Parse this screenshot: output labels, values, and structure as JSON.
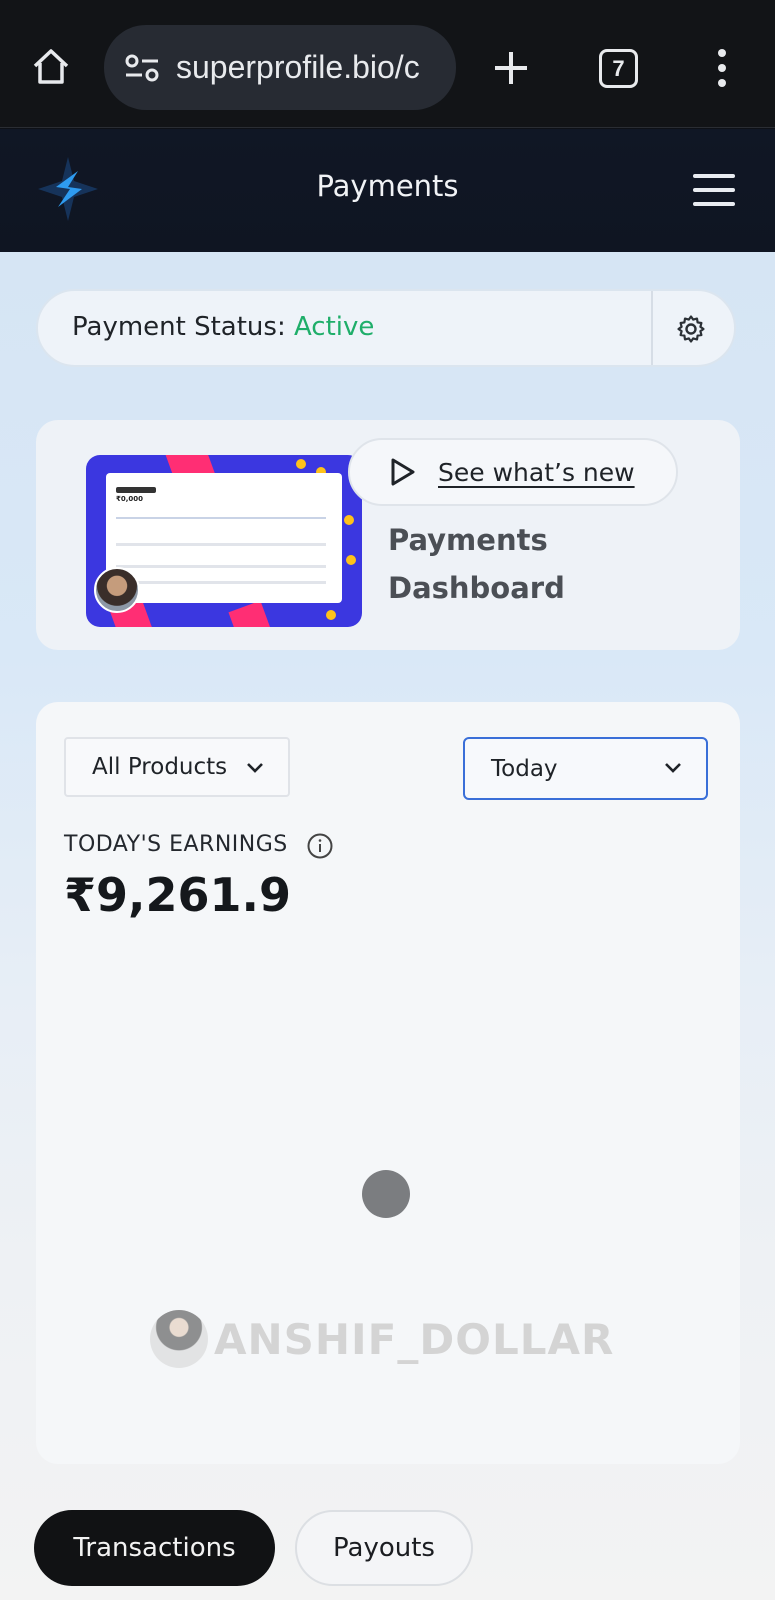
{
  "browser": {
    "url": "superprofile.bio/c",
    "tab_count": "7",
    "icons": {
      "home": "home-icon",
      "site_settings": "tune-icon",
      "new_tab": "plus-icon",
      "menu": "kebab-menu-icon"
    }
  },
  "header": {
    "title": "Payments",
    "logo": "superprofile-logo",
    "menu_icon": "hamburger-icon"
  },
  "payment_status": {
    "label": "Payment Status:",
    "value": "Active",
    "value_color": "#1fae6a",
    "settings_icon": "gear-icon"
  },
  "promo": {
    "button_label": "See what’s new",
    "title_line1": "Payments",
    "title_line2": "Dashboard",
    "thumbnail_amount": "₹0,000"
  },
  "filters": {
    "products": "All Products",
    "date_range": "Today"
  },
  "earnings": {
    "label": "TODAY'S EARNINGS",
    "value": "₹9,261.9"
  },
  "watermark": {
    "text": "ANSHIF_DOLLAR"
  },
  "tabs": {
    "transactions": "Transactions",
    "payouts": "Payouts",
    "active": "transactions"
  },
  "colors": {
    "accent_blue": "#3a6fd8",
    "active_green": "#1fae6a",
    "dark_tab": "#111214"
  }
}
